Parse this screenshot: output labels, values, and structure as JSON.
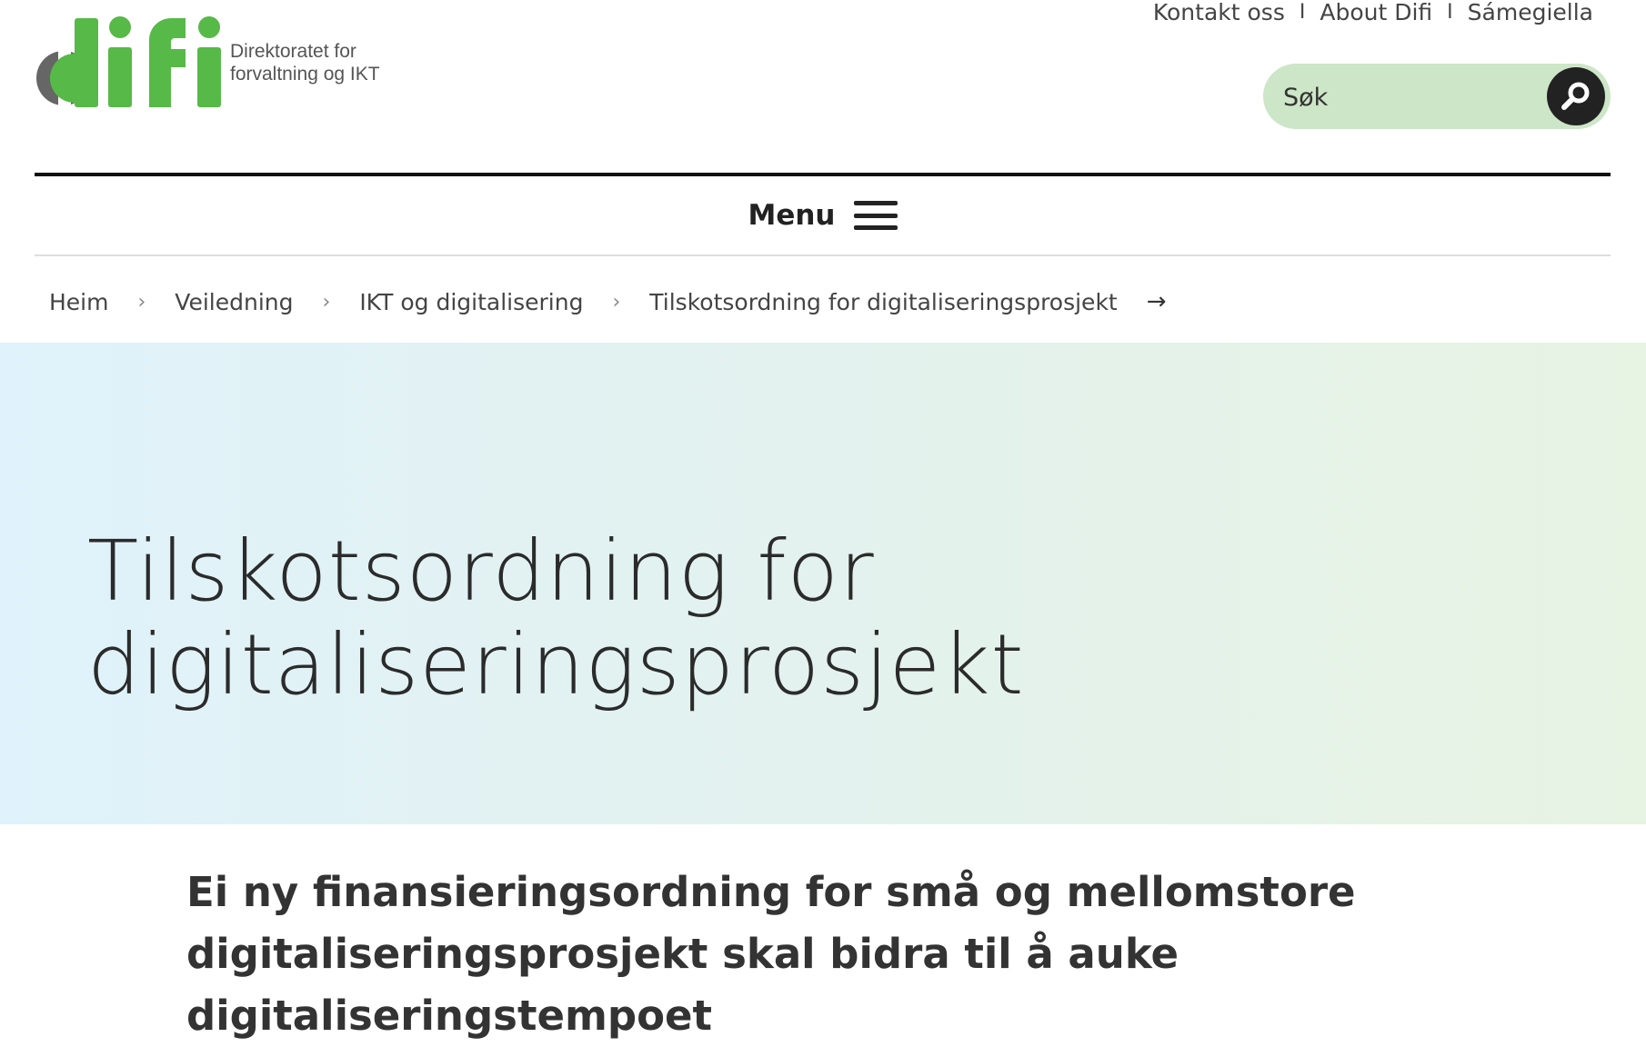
{
  "logo": {
    "wordmark": "difi",
    "subtitle_line1": "Direktoratet for",
    "subtitle_line2": "forvaltning og IKT",
    "colors": {
      "green": "#57b947",
      "grey": "#666666"
    }
  },
  "top_links": [
    {
      "label": "Kontakt oss"
    },
    {
      "label": "About Difi"
    },
    {
      "label": "Sámegiella"
    }
  ],
  "top_links_separator": "I",
  "search": {
    "placeholder": "Søk",
    "icon": "search-icon"
  },
  "menu": {
    "label": "Menu",
    "icon": "hamburger-icon"
  },
  "breadcrumb": {
    "items": [
      {
        "label": "Heim"
      },
      {
        "label": "Veiledning"
      },
      {
        "label": "IKT og digitalisering"
      },
      {
        "label": "Tilskotsordning for digitaliseringsprosjekt"
      }
    ],
    "separator": "›",
    "end_icon": "→"
  },
  "hero": {
    "title_line1": "Tilskotsordning for",
    "title_line2": "digitaliseringsprosjekt"
  },
  "intro": {
    "text": "Ei ny finansieringsordning for små og mellomstore digitaliseringsprosjekt skal bidra til å auke digitaliseringstempoet"
  },
  "colors": {
    "search_bg": "#cde6c7",
    "search_button": "#222222",
    "hero_gradient_start": "#e0f2fb",
    "hero_gradient_end": "#e7f3e3"
  }
}
